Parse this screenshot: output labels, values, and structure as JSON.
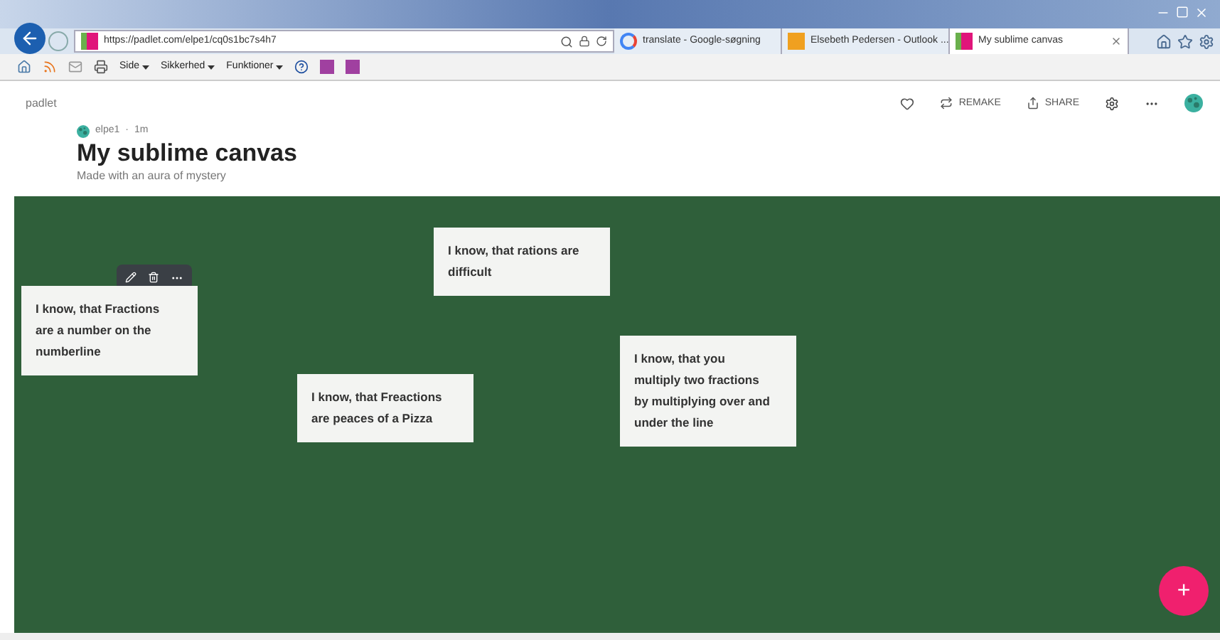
{
  "browser": {
    "address": "https://padlet.com/elpe1/cq0s1bc7s4h7",
    "tabs": [
      {
        "title": "translate - Google-søgning",
        "kind": "google",
        "selected": false
      },
      {
        "title": "Elsebeth Pedersen - Outlook ...",
        "kind": "outlook",
        "selected": false
      },
      {
        "title": "My sublime canvas",
        "kind": "padlet",
        "selected": true
      }
    ],
    "menus": [
      "Side",
      "Sikkerhed",
      "Funktioner"
    ]
  },
  "header": {
    "brand": "padlet",
    "author": "elpe1",
    "separator": "·",
    "age": "1m",
    "title": "My sublime canvas",
    "subtitle": "Made with an aura of mystery",
    "actions": [
      "REMAKE",
      "SHARE"
    ]
  },
  "notes": [
    {
      "text": "I know, that Fractions are a number on the numberline",
      "selected": true
    },
    {
      "text": "I know, that rations are difficult",
      "selected": false
    },
    {
      "text": "I know, that Freactions are peaces of a Pizza",
      "selected": false
    },
    {
      "text": "I know, that you multiply two fractions by multiplying over and under the line",
      "selected": false
    }
  ],
  "add_button": {
    "label": "+"
  }
}
